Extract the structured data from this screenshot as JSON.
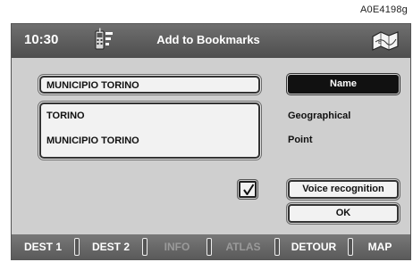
{
  "figure_ref": "A0E4198g",
  "header": {
    "time": "10:30",
    "title": "Add to Bookmarks"
  },
  "bookmark": {
    "name_value": "MUNICIPIO TORINO",
    "address_lines": [
      "TORINO",
      "MUNICIPIO TORINO"
    ]
  },
  "side": {
    "name_button": "Name",
    "label_geographical": "Geographical",
    "label_point": "Point",
    "voice_button": "Voice recognition",
    "ok_button": "OK"
  },
  "voice_checkbox_checked": true,
  "softkeys": [
    {
      "label": "DEST 1",
      "enabled": true
    },
    {
      "label": "DEST 2",
      "enabled": true
    },
    {
      "label": "INFO",
      "enabled": false
    },
    {
      "label": "ATLAS",
      "enabled": false
    },
    {
      "label": "DETOUR",
      "enabled": true
    },
    {
      "label": "MAP",
      "enabled": true
    }
  ],
  "icons": [
    "phone-icon",
    "map-icon",
    "check-icon"
  ]
}
